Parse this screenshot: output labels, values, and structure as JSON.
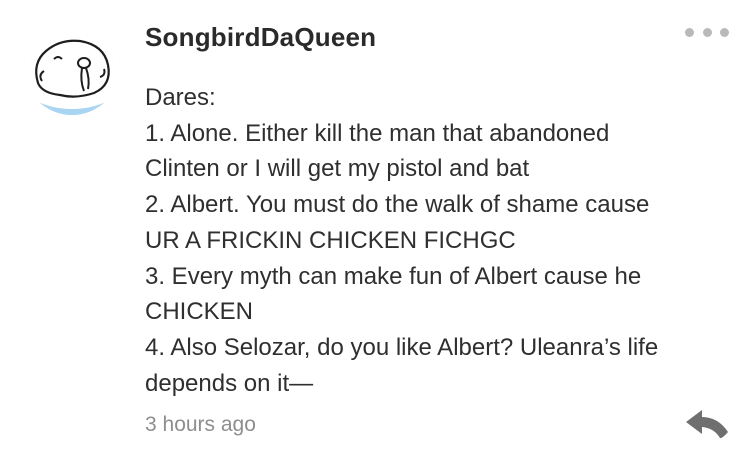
{
  "comment": {
    "username": "SongbirdDaQueen",
    "avatar_icon": "cartoon-blob-avatar-icon",
    "more_icon": "ellipsis-icon",
    "lines": [
      "Dares:",
      "1. Alone. Either kill the man that abandoned",
      "Clinten or I will get my pistol and bat",
      "2. Albert. You must do the walk of shame cause",
      "UR A FRICKIN CHICKEN FICHGC",
      "3. Every myth can make fun of Albert cause he",
      "CHICKEN",
      "4. Also Selozar, do you like Albert? Uleanra’s life",
      "depends on it—"
    ],
    "timestamp": "3 hours ago",
    "reply_icon": "reply-arrow-icon"
  },
  "colors": {
    "username": "#2a2a2a",
    "body_text": "#2f2f2f",
    "muted": "#8e8e8e",
    "dots": "#b9b9b9",
    "reply_icon": "#6f6f6f",
    "avatar_accent": "#a9d4f2"
  }
}
